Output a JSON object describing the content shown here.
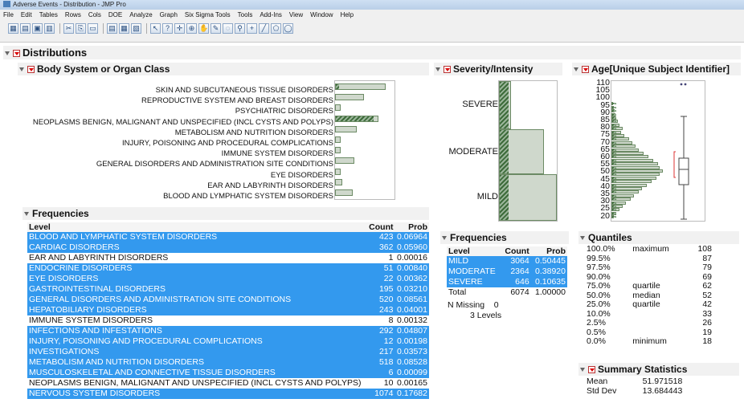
{
  "window": {
    "title": "Adverse Events - Distribution - JMP Pro"
  },
  "menu": [
    "File",
    "Edit",
    "Tables",
    "Rows",
    "Cols",
    "DOE",
    "Analyze",
    "Graph",
    "Six Sigma Tools",
    "Tools",
    "Add-Ins",
    "View",
    "Window",
    "Help"
  ],
  "toolbar_icons": [
    "new-table-icon",
    "open-icon",
    "save-icon",
    "print-icon",
    "cut-icon",
    "copy-icon",
    "paste-icon",
    "journal-icon",
    "layout-icon",
    "script-icon",
    "arrow-tool-icon",
    "help-tool-icon",
    "selection-tool-icon",
    "crosshair-tool-icon",
    "grabber-tool-icon",
    "brush-tool-icon",
    "lasso-tool-icon",
    "magnifier-tool-icon",
    "annotate-tool-icon",
    "line-tool-icon",
    "polygon-tool-icon",
    "simple-shape-tool-icon"
  ],
  "report": {
    "title": "Distributions",
    "body_system": {
      "title": "Body System or Organ Class",
      "labels": [
        "SKIN AND SUBCUTANEOUS TISSUE DISORDERS",
        "REPRODUCTIVE SYSTEM AND BREAST DISORDERS",
        "PSYCHIATRIC DISORDERS",
        "NEOPLASMS BENIGN, MALIGNANT AND UNSPECIFIED (INCL CYSTS AND POLYPS)",
        "METABOLISM AND NUTRITION DISORDERS",
        "INJURY, POISONING AND PROCEDURAL COMPLICATIONS",
        "IMMUNE SYSTEM DISORDERS",
        "GENERAL DISORDERS AND ADMINISTRATION SITE CONDITIONS",
        "EYE DISORDERS",
        "EAR AND LABYRINTH DISORDERS",
        "BLOOD AND LYMPHATIC SYSTEM DISORDERS"
      ],
      "bar_fraction": [
        0.88,
        0.5,
        0.1,
        0.75,
        0.38,
        0.1,
        0.1,
        0.33,
        0.1,
        0.12,
        0.3
      ]
    },
    "frequencies": {
      "title": "Frequencies",
      "headers": {
        "level": "Level",
        "count": "Count",
        "prob": "Prob"
      },
      "rows": [
        {
          "level": "BLOOD AND LYMPHATIC SYSTEM DISORDERS",
          "count": "423",
          "prob": "0.06964",
          "selected": true
        },
        {
          "level": "CARDIAC DISORDERS",
          "count": "362",
          "prob": "0.05960",
          "selected": true
        },
        {
          "level": "EAR AND LABYRINTH DISORDERS",
          "count": "1",
          "prob": "0.00016",
          "selected": false
        },
        {
          "level": "ENDOCRINE DISORDERS",
          "count": "51",
          "prob": "0.00840",
          "selected": true
        },
        {
          "level": "EYE DISORDERS",
          "count": "22",
          "prob": "0.00362",
          "selected": true
        },
        {
          "level": "GASTROINTESTINAL DISORDERS",
          "count": "195",
          "prob": "0.03210",
          "selected": true
        },
        {
          "level": "GENERAL DISORDERS AND ADMINISTRATION SITE CONDITIONS",
          "count": "520",
          "prob": "0.08561",
          "selected": true
        },
        {
          "level": "HEPATOBILIARY DISORDERS",
          "count": "243",
          "prob": "0.04001",
          "selected": true
        },
        {
          "level": "IMMUNE SYSTEM DISORDERS",
          "count": "8",
          "prob": "0.00132",
          "selected": false
        },
        {
          "level": "INFECTIONS AND INFESTATIONS",
          "count": "292",
          "prob": "0.04807",
          "selected": true
        },
        {
          "level": "INJURY, POISONING AND PROCEDURAL COMPLICATIONS",
          "count": "12",
          "prob": "0.00198",
          "selected": true
        },
        {
          "level": "INVESTIGATIONS",
          "count": "217",
          "prob": "0.03573",
          "selected": true
        },
        {
          "level": "METABOLISM AND NUTRITION DISORDERS",
          "count": "518",
          "prob": "0.08528",
          "selected": true
        },
        {
          "level": "MUSCULOSKELETAL AND CONNECTIVE TISSUE DISORDERS",
          "count": "6",
          "prob": "0.00099",
          "selected": true
        },
        {
          "level": "NEOPLASMS BENIGN, MALIGNANT AND UNSPECIFIED (INCL CYSTS AND POLYPS)",
          "count": "10",
          "prob": "0.00165",
          "selected": false
        },
        {
          "level": "NERVOUS SYSTEM DISORDERS",
          "count": "1074",
          "prob": "0.17682",
          "selected": true
        }
      ]
    },
    "severity": {
      "title": "Severity/Intensity",
      "labels": [
        "SEVERE",
        "MODERATE",
        "MILD"
      ],
      "frequencies_title": "Frequencies",
      "headers": {
        "level": "Level",
        "count": "Count",
        "prob": "Prob"
      },
      "rows": [
        {
          "level": "MILD",
          "count": "3064",
          "prob": "0.50445"
        },
        {
          "level": "MODERATE",
          "count": "2364",
          "prob": "0.38920"
        },
        {
          "level": "SEVERE",
          "count": "646",
          "prob": "0.10635"
        }
      ],
      "total_label": "Total",
      "total_count": "6074",
      "total_prob": "1.00000",
      "missing_label": "N Missing",
      "missing_value": "0",
      "levels_text": "3  Levels"
    },
    "age": {
      "title": "Age[Unique Subject Identifier]",
      "ticks": [
        "110",
        "105",
        "100",
        "95",
        "90",
        "85",
        "80",
        "75",
        "70",
        "65",
        "60",
        "55",
        "50",
        "45",
        "40",
        "35",
        "30",
        "25",
        "20"
      ],
      "quantiles_title": "Quantiles",
      "quantiles": [
        {
          "pct": "100.0%",
          "name": "maximum",
          "value": "108"
        },
        {
          "pct": "99.5%",
          "name": "",
          "value": "87"
        },
        {
          "pct": "97.5%",
          "name": "",
          "value": "79"
        },
        {
          "pct": "90.0%",
          "name": "",
          "value": "69"
        },
        {
          "pct": "75.0%",
          "name": "quartile",
          "value": "62"
        },
        {
          "pct": "50.0%",
          "name": "median",
          "value": "52"
        },
        {
          "pct": "25.0%",
          "name": "quartile",
          "value": "42"
        },
        {
          "pct": "10.0%",
          "name": "",
          "value": "33"
        },
        {
          "pct": "2.5%",
          "name": "",
          "value": "26"
        },
        {
          "pct": "0.5%",
          "name": "",
          "value": "19"
        },
        {
          "pct": "0.0%",
          "name": "minimum",
          "value": "18"
        }
      ],
      "summary_title": "Summary Statistics",
      "summary": [
        {
          "name": "Mean",
          "value": "51.971518"
        },
        {
          "name": "Std Dev",
          "value": "13.684443"
        }
      ]
    }
  },
  "colors": {
    "selected_row": "#3399ee",
    "bar_fill": "#cfd8cc",
    "bar_stroke": "#6b8a64"
  }
}
